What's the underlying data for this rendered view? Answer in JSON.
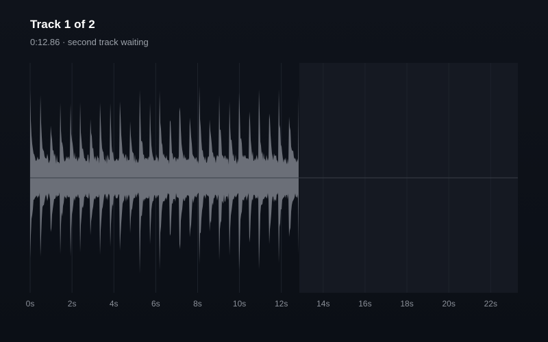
{
  "header": {
    "title": "Track 1 of 2",
    "subtitle": "0:12.86 · second track waiting"
  },
  "timeline": {
    "duration_s": 23.3,
    "recorded_s": 12.86,
    "tick_labels": [
      "0s",
      "2s",
      "4s",
      "6s",
      "8s",
      "10s",
      "12s",
      "14s",
      "16s",
      "18s",
      "20s",
      "22s"
    ],
    "tick_values": [
      0,
      2,
      4,
      6,
      8,
      10,
      12,
      14,
      16,
      18,
      20,
      22
    ]
  },
  "waveform": {
    "beat_interval_s": 0.475,
    "peak_amplitude": 0.82,
    "base_amplitude": 0.17
  },
  "colors": {
    "background": "#0d1118",
    "waveform": "#6b6f78",
    "waveform_peak": "#8a8e96",
    "pending_region": "#151922",
    "gridline": "#1e232c",
    "tick_label": "#8b9099",
    "baseline": "#3a3f48"
  }
}
